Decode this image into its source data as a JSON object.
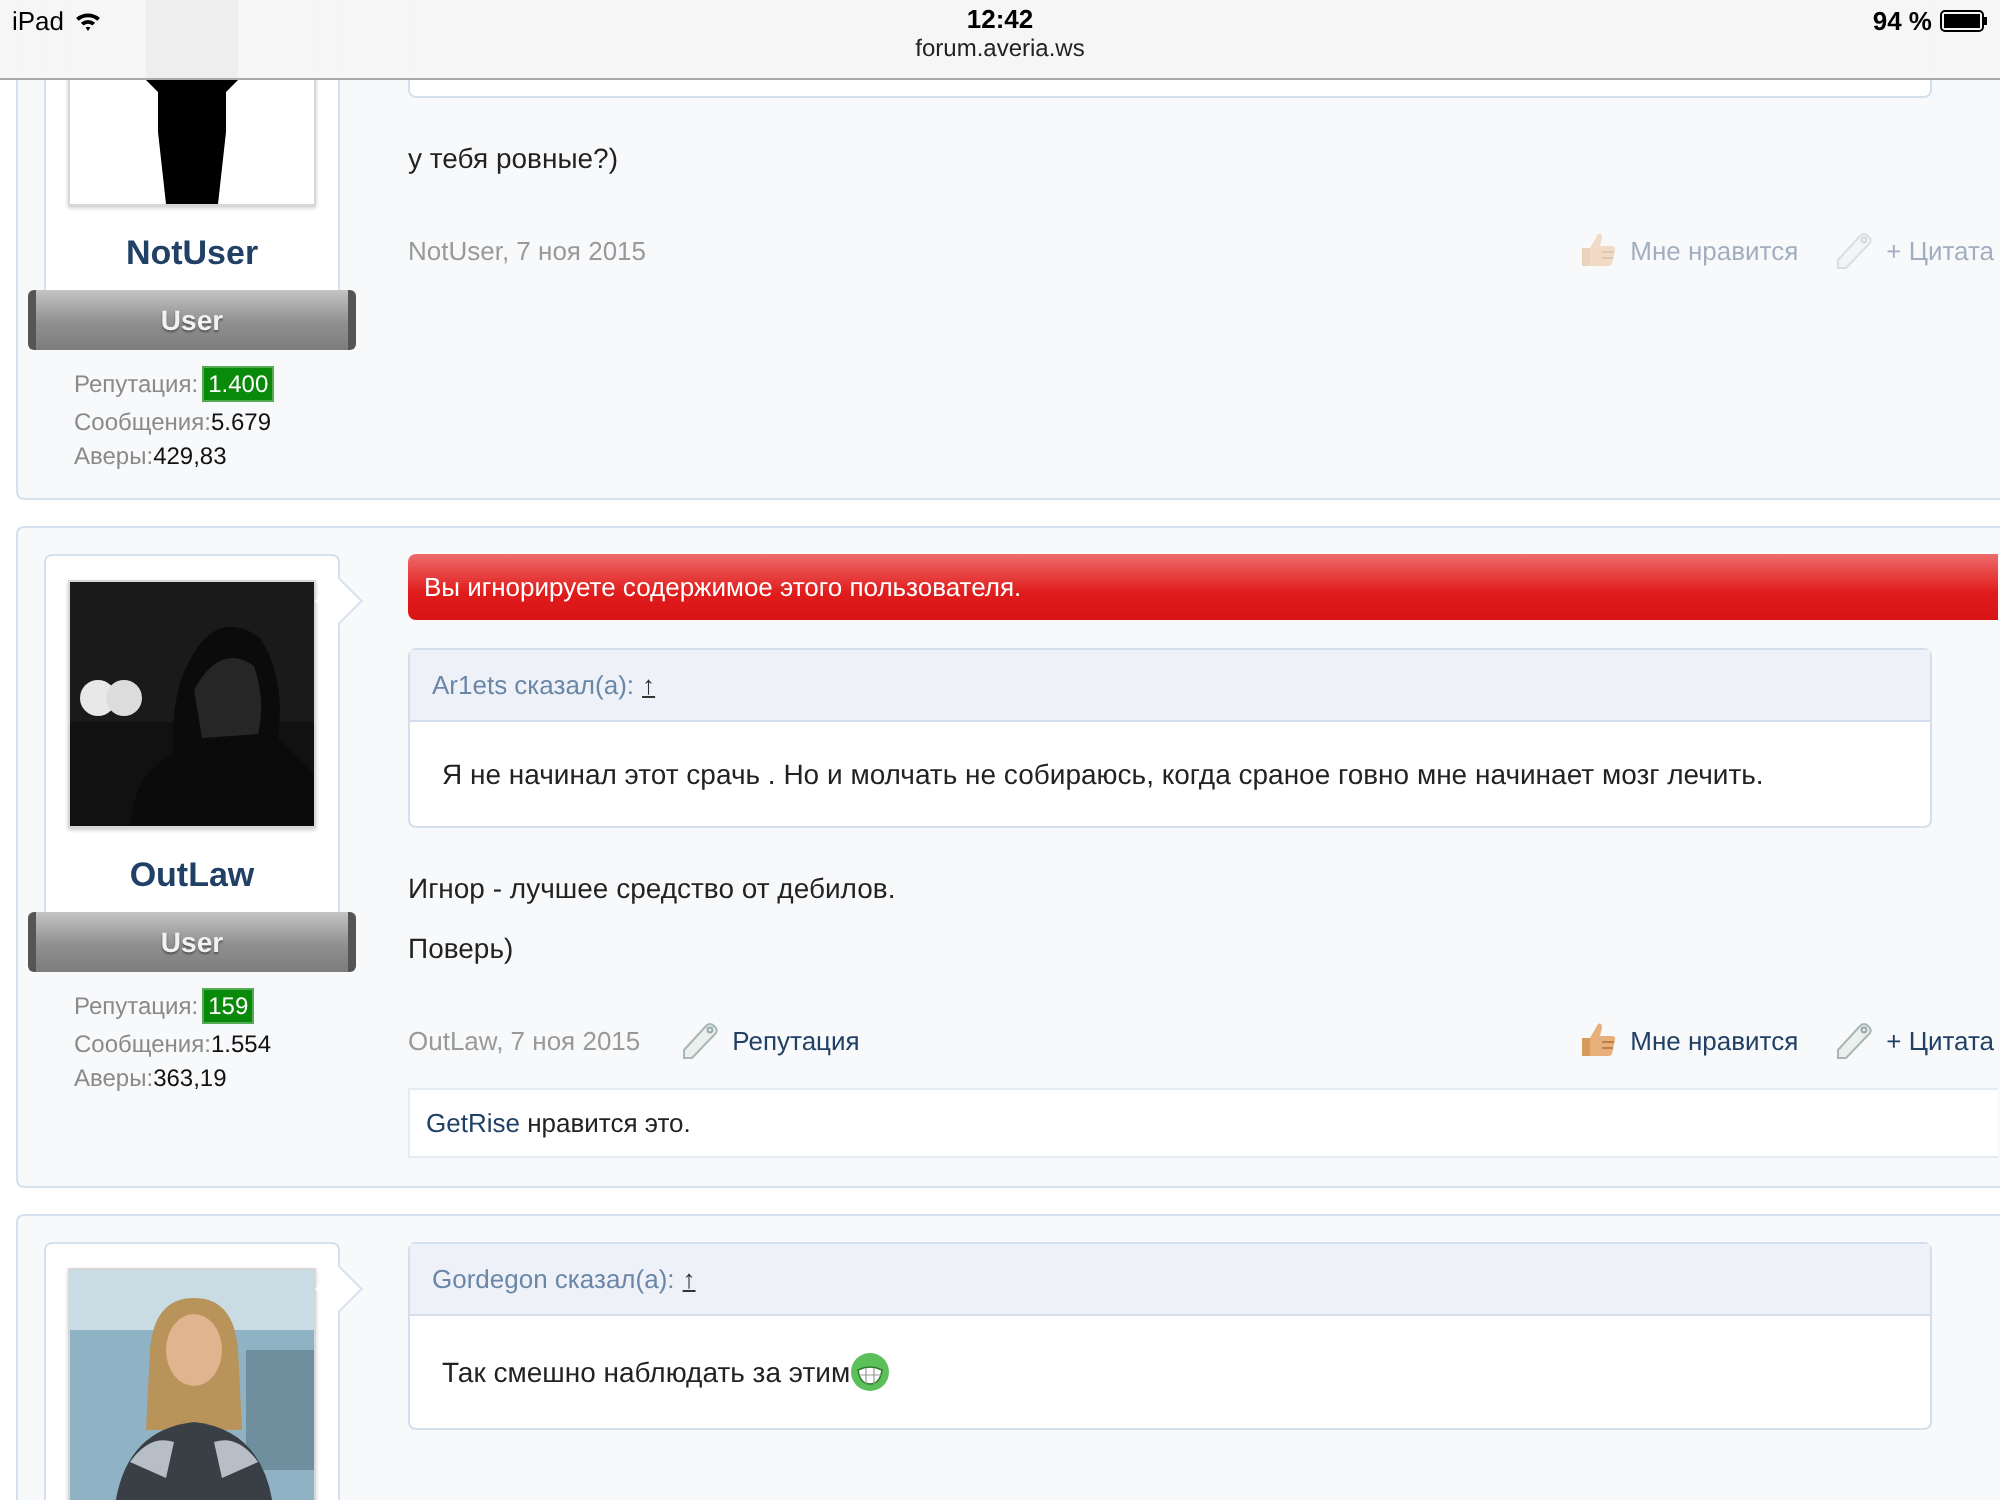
{
  "status_bar": {
    "device": "iPad",
    "time": "12:42",
    "url": "forum.averia.ws",
    "battery": "94 %"
  },
  "posts": [
    {
      "user": {
        "name": "NotUser",
        "title": "User",
        "stats": [
          {
            "label": "Репутация:",
            "value": "1.400",
            "kind": "badge"
          },
          {
            "label": "Сообщения:",
            "value": "5.679",
            "kind": "plain"
          },
          {
            "label": "Аверы:",
            "value": "429,83",
            "kind": "plain"
          }
        ]
      },
      "quote_tail": true,
      "body": [
        "у тебя ровные?)"
      ],
      "meta": "NotUser, 7 ноя 2015",
      "actions": [
        {
          "kind": "like",
          "label": "Мне нравится",
          "faded": true
        },
        {
          "kind": "quote",
          "label": "+ Цитата",
          "faded": true
        }
      ]
    },
    {
      "user": {
        "name": "OutLaw",
        "title": "User",
        "stats": [
          {
            "label": "Репутация:",
            "value": "159",
            "kind": "badge"
          },
          {
            "label": "Сообщения:",
            "value": "1.554",
            "kind": "plain"
          },
          {
            "label": "Аверы:",
            "value": "363,19",
            "kind": "plain"
          }
        ]
      },
      "notice": "Вы игнорируете содержимое этого пользователя.",
      "quote": {
        "author": "Ar1ets сказал(а):",
        "jump": "↑",
        "text": "Я не начинал этот срачь . Но и молчать не собираюсь, когда сраное говно мне начинает мозг лечить.",
        "emoji": false
      },
      "body": [
        "Игнор - лучшее средство от дебилов.",
        "Поверь)"
      ],
      "meta": "OutLaw, 7 ноя 2015",
      "actions": [
        {
          "kind": "reputation",
          "label": "Репутация",
          "faded": false
        },
        {
          "kind": "like",
          "label": "Мне нравится",
          "faded": false
        },
        {
          "kind": "quote",
          "label": "+ Цитата",
          "faded": false
        }
      ],
      "likes": {
        "user": "GetRise",
        "text": " нравится это."
      }
    },
    {
      "quote": {
        "author": "Gordegon сказал(а):",
        "jump": "↑",
        "text": "Так смешно наблюдать за этим",
        "emoji": true
      }
    }
  ]
}
